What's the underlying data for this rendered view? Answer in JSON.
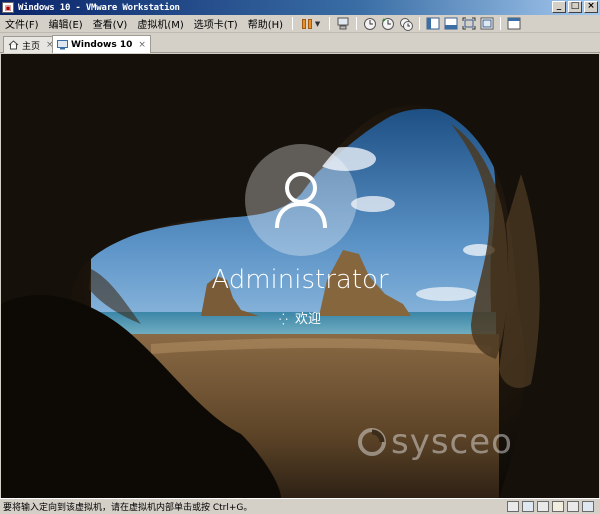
{
  "window": {
    "title": "Windows 10 - VMware Workstation",
    "controls": [
      "_",
      "□",
      "×"
    ]
  },
  "menubar": {
    "items": [
      "文件(F)",
      "编辑(E)",
      "查看(V)",
      "虚拟机(M)",
      "选项卡(T)",
      "帮助(H)"
    ],
    "toolbar_icons": [
      "pause-icon",
      "send-ctrl-alt-del-icon",
      "snapshot-icon",
      "revert-snapshot-icon",
      "snapshot-manager-icon",
      "show-library-icon",
      "thumbnail-icon",
      "fullscreen-icon",
      "unity-icon",
      "console-view-icon"
    ]
  },
  "tabs": [
    {
      "label": "主页",
      "icon": "home-icon",
      "close": "×",
      "active": false
    },
    {
      "label": "Windows 10",
      "icon": "vm-icon",
      "close": "×",
      "active": true
    }
  ],
  "lockscreen": {
    "username": "Administrator",
    "status": "欢迎",
    "spinner": "⁛"
  },
  "watermark": {
    "text": "sysceo"
  },
  "statusbar": {
    "message": "要将输入定向到该虚拟机，请在虚拟机内部单击或按 Ctrl+G。",
    "icons": [
      "hdd-icon",
      "network-icon",
      "usb-icon",
      "sound-icon",
      "printer-icon",
      "display-icon"
    ]
  }
}
